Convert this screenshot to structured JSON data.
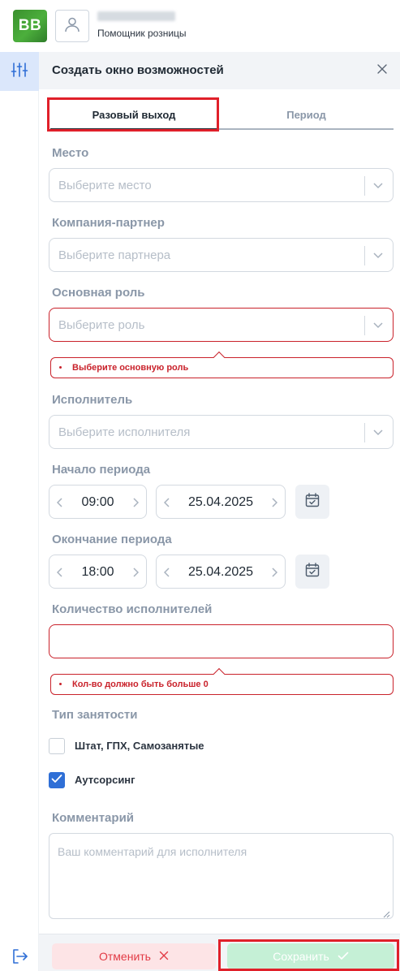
{
  "header": {
    "logo_text": "BB",
    "user_role": "Помощник розницы",
    "icons": {
      "avatar": "user-icon"
    }
  },
  "rail": {
    "icons": {
      "active": "sliders-icon",
      "exit": "logout-icon"
    }
  },
  "panel": {
    "title": "Создать окно возможностей",
    "tabs": [
      {
        "label": "Разовый выход",
        "active": true
      },
      {
        "label": "Период",
        "active": false
      }
    ],
    "fields": {
      "place": {
        "label": "Место",
        "placeholder": "Выберите место"
      },
      "partner": {
        "label": "Компания-партнер",
        "placeholder": "Выберите партнера"
      },
      "role": {
        "label": "Основная роль",
        "placeholder": "Выберите роль",
        "error": "Выберите основную роль"
      },
      "executor": {
        "label": "Исполнитель",
        "placeholder": "Выберите исполнителя"
      },
      "start": {
        "label": "Начало периода",
        "time": "09:00",
        "date": "25.04.2025"
      },
      "end": {
        "label": "Окончание периода",
        "time": "18:00",
        "date": "25.04.2025"
      },
      "count": {
        "label": "Количество исполнителей",
        "value": "",
        "error": "Кол-во должно быть больше 0"
      },
      "employment": {
        "label": "Тип занятости",
        "options": [
          {
            "label": "Штат, ГПХ, Самозанятые",
            "checked": false
          },
          {
            "label": "Аутсорсинг",
            "checked": true
          }
        ]
      },
      "comment": {
        "label": "Комментарий",
        "placeholder": "Ваш комментарий для исполнителя"
      }
    },
    "buttons": {
      "cancel": "Отменить",
      "save": "Сохранить"
    }
  },
  "colors": {
    "accent": "#2f6fd6",
    "error": "#c9222b",
    "highlight": "#e0202a",
    "save_bg": "#c5f0d6",
    "cancel_bg": "#fde4e6",
    "logo": "#3a8f2e"
  }
}
